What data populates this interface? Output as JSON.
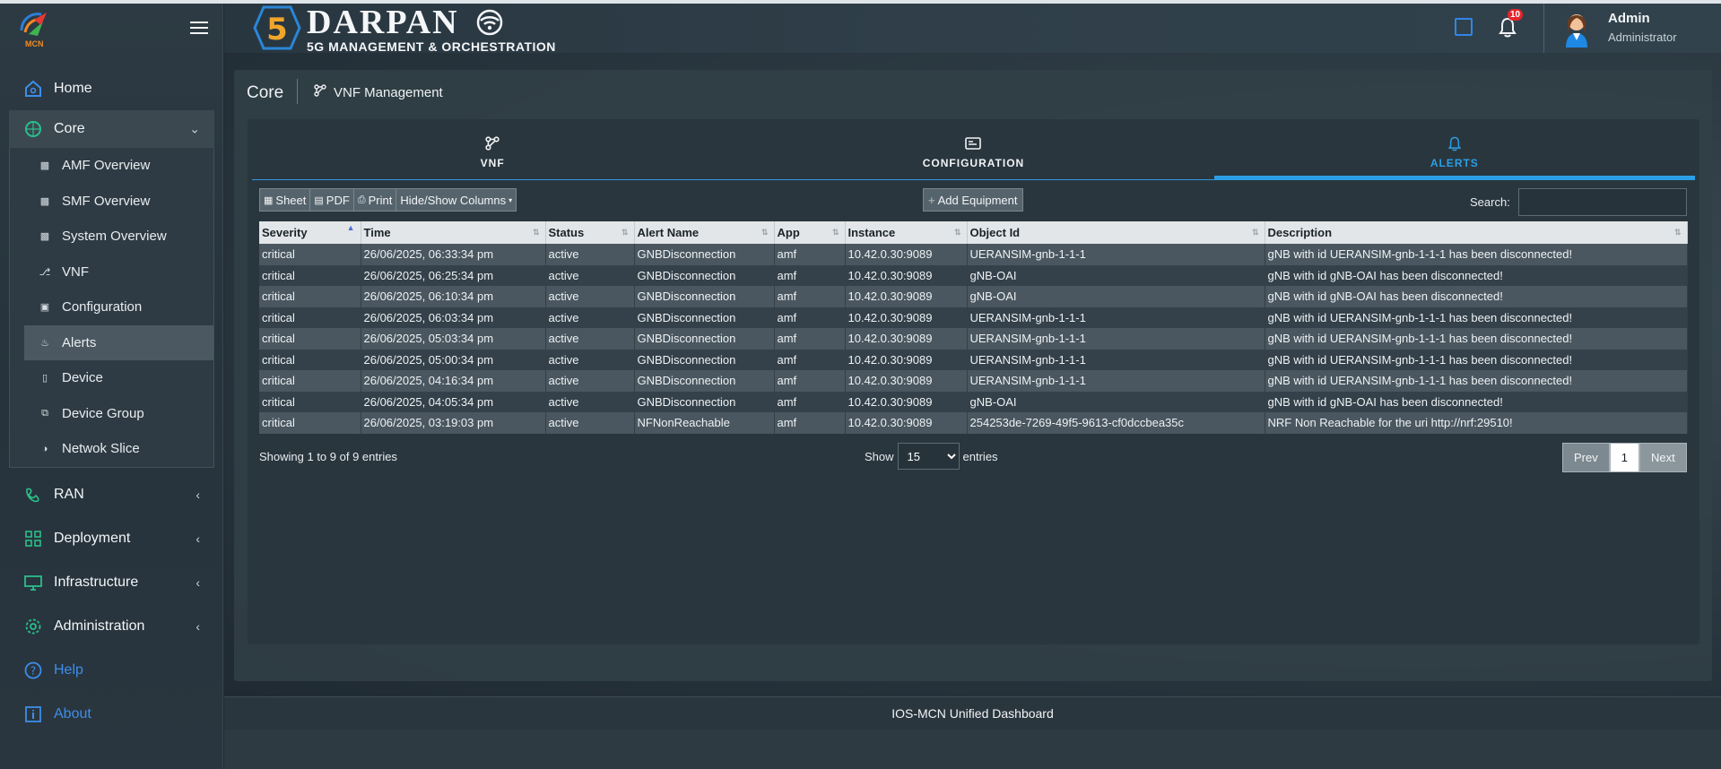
{
  "app": {
    "logo_text": "MCN",
    "brand_title": "DARPAN",
    "brand_subtitle": "5G MANAGEMENT & ORCHESTRATION",
    "brand_number": "5"
  },
  "header": {
    "notification_count": "10",
    "user_name": "Admin",
    "user_role": "Administrator"
  },
  "sidebar": {
    "items": [
      {
        "label": "Home",
        "icon": "home-icon"
      },
      {
        "label": "Core",
        "icon": "core-icon"
      },
      {
        "label": "RAN",
        "icon": "antenna-icon"
      },
      {
        "label": "Deployment",
        "icon": "grid-icon"
      },
      {
        "label": "Infrastructure",
        "icon": "monitor-icon"
      },
      {
        "label": "Administration",
        "icon": "gear-icon"
      },
      {
        "label": "Help",
        "icon": "help-icon"
      },
      {
        "label": "About",
        "icon": "info-icon"
      }
    ],
    "core_sub": [
      {
        "label": "AMF Overview",
        "icon": "bar-chart-icon"
      },
      {
        "label": "SMF Overview",
        "icon": "bar-chart-icon"
      },
      {
        "label": "System Overview",
        "icon": "bar-chart-icon"
      },
      {
        "label": "VNF",
        "icon": "branch-icon"
      },
      {
        "label": "Configuration",
        "icon": "card-icon"
      },
      {
        "label": "Alerts",
        "icon": "bell-icon"
      },
      {
        "label": "Device",
        "icon": "phone-icon"
      },
      {
        "label": "Device Group",
        "icon": "copy-icon"
      },
      {
        "label": "Netwok Slice",
        "icon": "half-circle-icon"
      }
    ]
  },
  "breadcrumb": {
    "section": "Core",
    "page": "VNF Management"
  },
  "tabs": [
    {
      "label": "VNF"
    },
    {
      "label": "CONFIGURATION"
    },
    {
      "label": "ALERTS"
    }
  ],
  "toolbar": {
    "sheet": "Sheet",
    "pdf": "PDF",
    "print": "Print",
    "columns": "Hide/Show Columns",
    "add_equipment": "Add Equipment",
    "search_label": "Search:",
    "search_value": ""
  },
  "table": {
    "headers": [
      "Severity",
      "Time",
      "Status",
      "Alert Name",
      "App",
      "Instance",
      "Object Id",
      "Description"
    ],
    "rows": [
      [
        "critical",
        "26/06/2025, 06:33:34 pm",
        "active",
        "GNBDisconnection",
        "amf",
        "10.42.0.30:9089",
        "UERANSIM-gnb-1-1-1",
        "gNB with id UERANSIM-gnb-1-1-1 has been disconnected!"
      ],
      [
        "critical",
        "26/06/2025, 06:25:34 pm",
        "active",
        "GNBDisconnection",
        "amf",
        "10.42.0.30:9089",
        "gNB-OAI",
        "gNB with id gNB-OAI has been disconnected!"
      ],
      [
        "critical",
        "26/06/2025, 06:10:34 pm",
        "active",
        "GNBDisconnection",
        "amf",
        "10.42.0.30:9089",
        "gNB-OAI",
        "gNB with id gNB-OAI has been disconnected!"
      ],
      [
        "critical",
        "26/06/2025, 06:03:34 pm",
        "active",
        "GNBDisconnection",
        "amf",
        "10.42.0.30:9089",
        "UERANSIM-gnb-1-1-1",
        "gNB with id UERANSIM-gnb-1-1-1 has been disconnected!"
      ],
      [
        "critical",
        "26/06/2025, 05:03:34 pm",
        "active",
        "GNBDisconnection",
        "amf",
        "10.42.0.30:9089",
        "UERANSIM-gnb-1-1-1",
        "gNB with id UERANSIM-gnb-1-1-1 has been disconnected!"
      ],
      [
        "critical",
        "26/06/2025, 05:00:34 pm",
        "active",
        "GNBDisconnection",
        "amf",
        "10.42.0.30:9089",
        "UERANSIM-gnb-1-1-1",
        "gNB with id UERANSIM-gnb-1-1-1 has been disconnected!"
      ],
      [
        "critical",
        "26/06/2025, 04:16:34 pm",
        "active",
        "GNBDisconnection",
        "amf",
        "10.42.0.30:9089",
        "UERANSIM-gnb-1-1-1",
        "gNB with id UERANSIM-gnb-1-1-1 has been disconnected!"
      ],
      [
        "critical",
        "26/06/2025, 04:05:34 pm",
        "active",
        "GNBDisconnection",
        "amf",
        "10.42.0.30:9089",
        "gNB-OAI",
        "gNB with id gNB-OAI has been disconnected!"
      ],
      [
        "critical",
        "26/06/2025, 03:19:03 pm",
        "active",
        "NFNonReachable",
        "amf",
        "10.42.0.30:9089",
        "254253de-7269-49f5-9613-cf0dccbea35c",
        "NRF Non Reachable for the uri http://nrf:29510!"
      ]
    ]
  },
  "table_footer": {
    "info": "Showing 1 to 9 of 9 entries",
    "show_label": "Show",
    "page_length": "15",
    "entries_label": "entries",
    "prev": "Prev",
    "current_page": "1",
    "next": "Next"
  },
  "footer": {
    "text": "IOS-MCN Unified Dashboard"
  },
  "colors": {
    "accent": "#2b9fe6",
    "link": "#3d8eea",
    "badge": "#e5252b",
    "sidebar_icon": "#2bbf8a"
  }
}
